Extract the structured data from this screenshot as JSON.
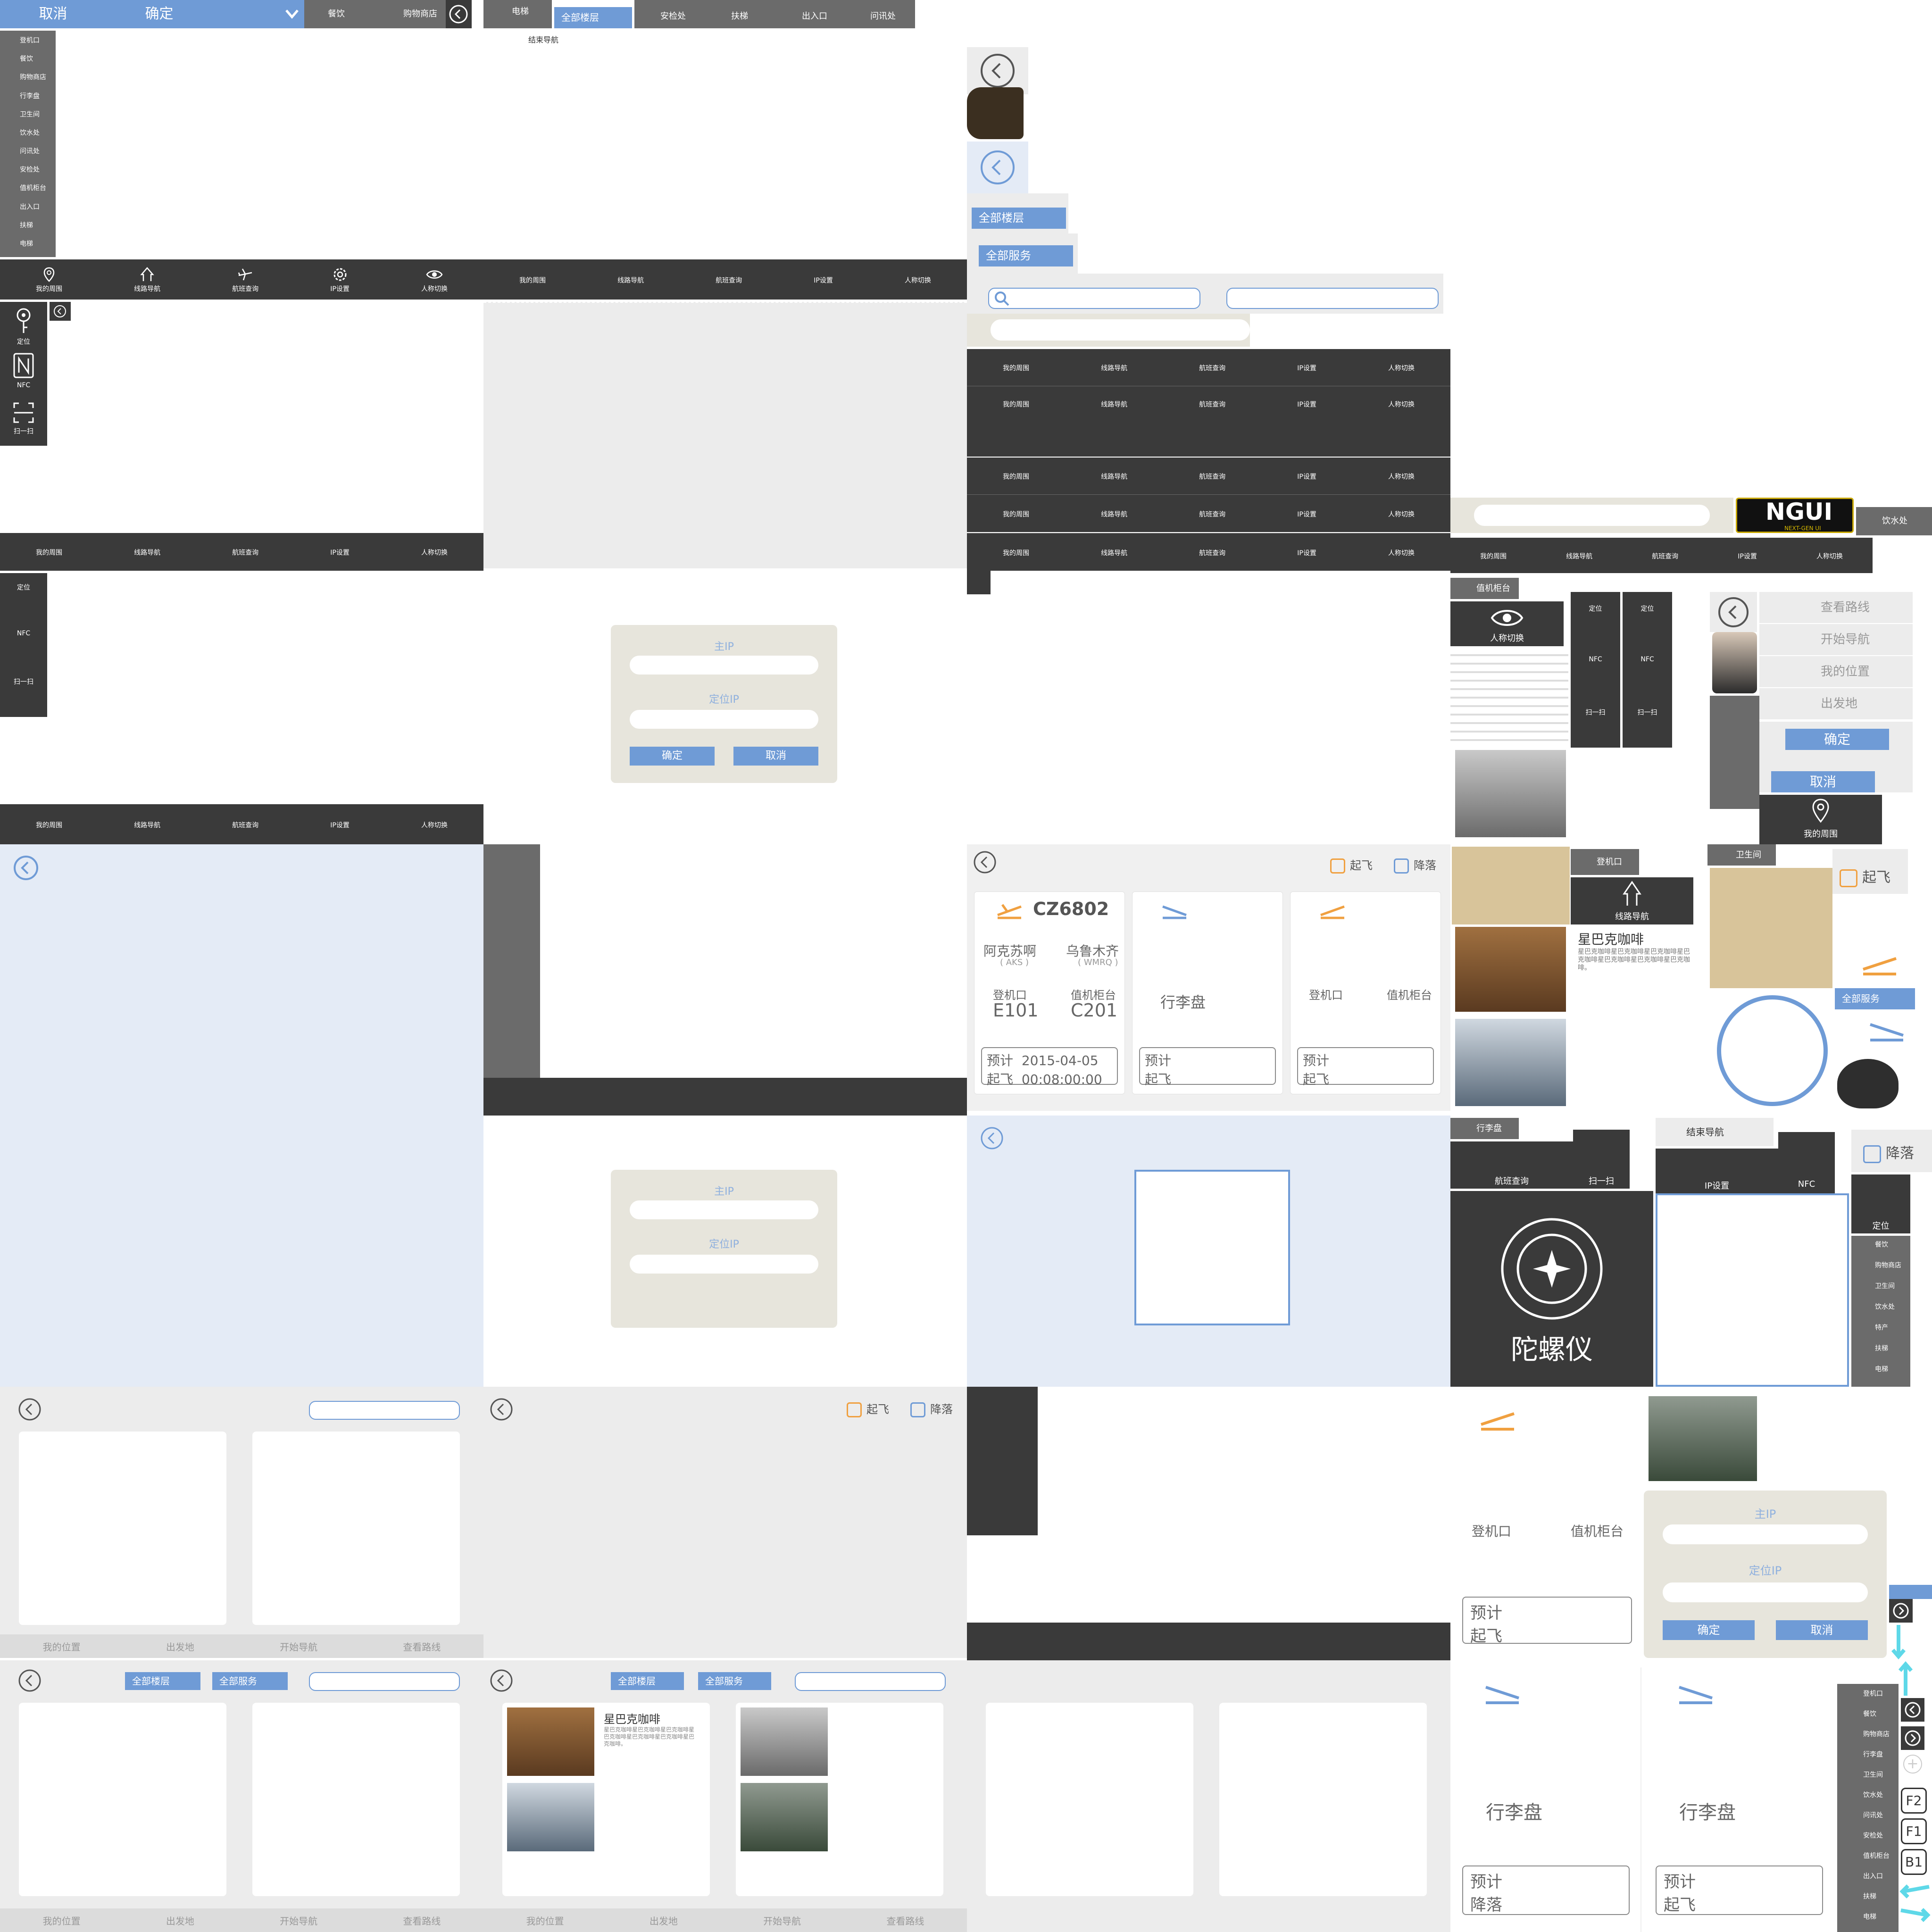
{
  "top_bar": {
    "cancel": "取消",
    "confirm": "确定",
    "food": "餐饮",
    "shop": "购物商店"
  },
  "mid_bar": {
    "elevator": "电梯",
    "all_floors": "全部楼层",
    "security": "安检处",
    "escalator": "扶梯",
    "exit": "出入口",
    "info": "问讯处",
    "end_nav": "结束导航"
  },
  "sidebar_categories": [
    "登机口",
    "餐饮",
    "购物商店",
    "行李盘",
    "卫生间",
    "饮水处",
    "问讯处",
    "安检处",
    "值机柜台",
    "出入口",
    "扶梯",
    "电梯"
  ],
  "nav": {
    "around": "我的周围",
    "route": "线路导航",
    "flight": "航班查询",
    "ip": "IP设置",
    "view": "人称切换"
  },
  "side_tools": {
    "locate": "定位",
    "nfc": "NFC",
    "scan": "扫一扫"
  },
  "ip_dialog": {
    "main_ip": "主IP",
    "locate_ip": "定位IP",
    "ok": "确定",
    "cancel": "取消"
  },
  "filters": {
    "takeoff": "起飞",
    "landing": "降落",
    "all_floors": "全部楼层",
    "all_services": "全部服务"
  },
  "flight": {
    "number": "CZ6802",
    "from": "阿克苏啊",
    "from_code": "( AKS )",
    "to": "乌鲁木齐",
    "to_code": "( WMRQ )",
    "gate_label": "登机口",
    "gate": "E101",
    "counter_label": "值机柜台",
    "counter": "C201",
    "expected": "预计",
    "takeoff": "起飞",
    "landing": "降落",
    "date": "2015-04-05",
    "time": "00:08:00:00",
    "baggage": "行李盘"
  },
  "route_panel": {
    "view_route": "查看路线",
    "start_nav": "开始导航",
    "my_location": "我的位置",
    "origin": "出发地",
    "ok": "确定",
    "cancel": "取消",
    "my_around": "我的周围"
  },
  "bottom_bar": {
    "my_location": "我的位置",
    "origin": "出发地",
    "start_nav": "开始导航",
    "view_route": "查看路线"
  },
  "store": {
    "name": "星巴克咖啡",
    "desc": "星巴克咖啡星巴克咖啡星巴克咖啡星巴克咖啡星巴克咖啡星巴克咖啡星巴克咖啡。"
  },
  "misc": {
    "water": "饮水处",
    "checkin_counter": "值机柜台",
    "gate": "登机口",
    "toilet": "卫生间",
    "baggage": "行李盘",
    "gyro": "陀螺仪",
    "all_services": "全部服务",
    "end_nav": "结束导航",
    "nfc": "NFC",
    "ip": "IP设置",
    "flight": "航班查询",
    "scan": "扫一扫",
    "locate": "定位",
    "ngui": "NGUI",
    "ngui_sub": "NEXT-GEN UI",
    "floors": [
      "F2",
      "F1",
      "B1"
    ]
  },
  "sidebar_small": [
    "餐饮",
    "购物商店",
    "卫生间",
    "饮水处",
    "特产",
    "扶梯",
    "电梯"
  ],
  "sidebar_small2": [
    "登机口",
    "餐饮",
    "购物商店",
    "行李盘",
    "卫生间",
    "饮水处",
    "问讯处",
    "安检处",
    "值机柜台",
    "出入口",
    "扶梯",
    "电梯"
  ]
}
